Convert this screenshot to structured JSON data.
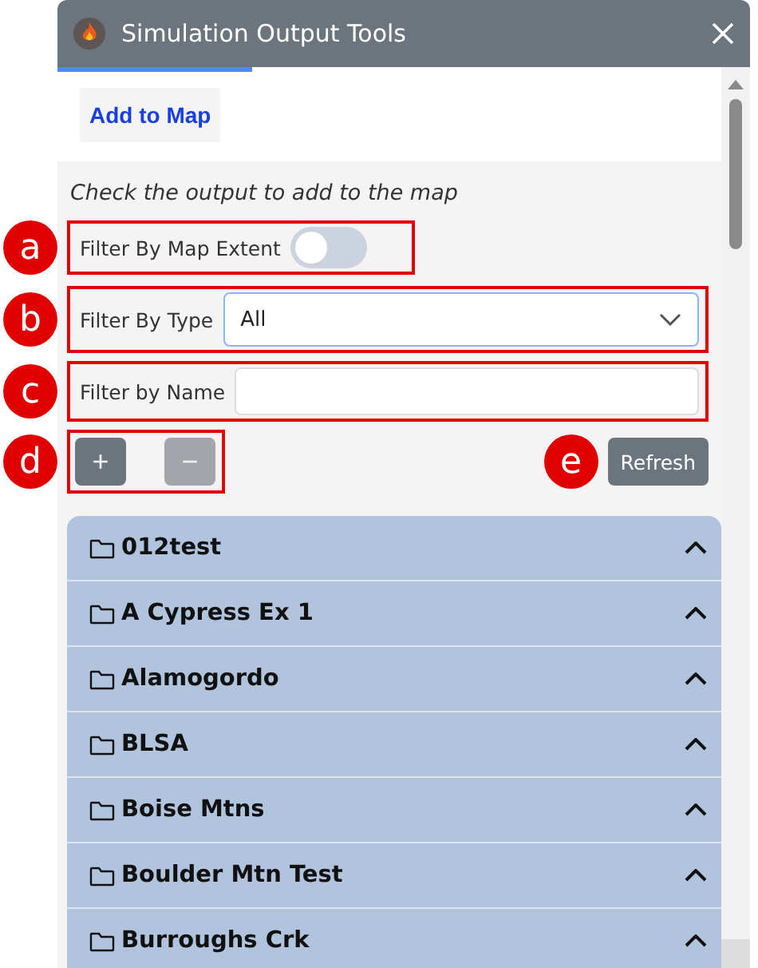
{
  "window": {
    "title": "Simulation Output Tools"
  },
  "tabs": [
    {
      "label": "Add to Map",
      "selected": true
    }
  ],
  "instruction": "Check the output to add to the map",
  "filters": {
    "extent": {
      "label": "Filter By Map Extent",
      "on": false,
      "callout": "a"
    },
    "type": {
      "label": "Filter By Type",
      "value": "All",
      "callout": "b"
    },
    "name": {
      "label": "Filter by Name",
      "callout": "c"
    }
  },
  "zoom_buttons": {
    "callout": "d",
    "add": {
      "label": "+",
      "disabled": false
    },
    "remove": {
      "label": "−",
      "disabled": true
    }
  },
  "refresh": {
    "label": "Refresh",
    "callout": "e"
  },
  "folders": [
    {
      "name": "012test"
    },
    {
      "name": "A Cypress Ex 1"
    },
    {
      "name": "Alamogordo"
    },
    {
      "name": "BLSA"
    },
    {
      "name": "Boise Mtns"
    },
    {
      "name": "Boulder Mtn Test"
    },
    {
      "name": "Burroughs Crk"
    }
  ]
}
